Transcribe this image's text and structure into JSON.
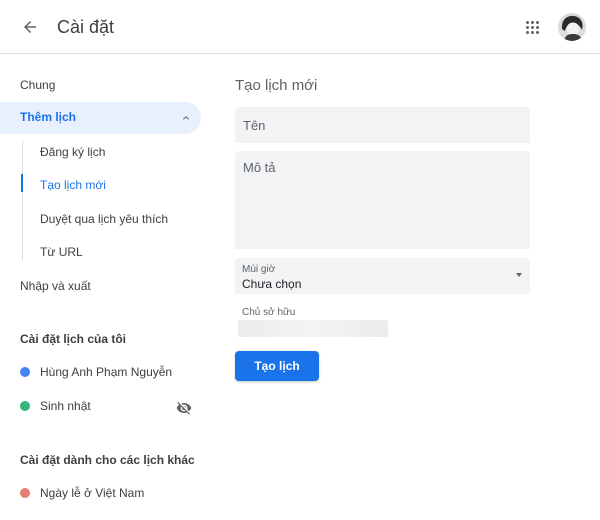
{
  "header": {
    "title": "Cài đặt",
    "back_icon": "arrow-left-icon",
    "apps_icon": "apps-grid-icon"
  },
  "sidebar": {
    "general": "Chung",
    "add_calendar": {
      "label": "Thêm lịch",
      "expanded": true,
      "children": [
        {
          "label": "Đăng ký lịch",
          "active": false
        },
        {
          "label": "Tạo lịch mới",
          "active": true
        },
        {
          "label": "Duyệt qua lịch yêu thích",
          "active": false
        },
        {
          "label": "Từ URL",
          "active": false
        }
      ]
    },
    "import_export": "Nhập và xuất",
    "my_calendars": {
      "title": "Cài đặt lịch của tôi",
      "items": [
        {
          "label": "Hùng Anh Phạm Nguyễn",
          "color": "#4285f4"
        },
        {
          "label": "Sinh nhật",
          "color": "#33b679",
          "hidden_icon": "eye-off-icon"
        }
      ]
    },
    "other_calendars": {
      "title": "Cài đặt dành cho các lịch khác",
      "items": [
        {
          "label": "Ngày lễ ở Việt Nam",
          "color": "#e67c73"
        }
      ]
    }
  },
  "main": {
    "title": "Tạo lịch mới",
    "name_placeholder": "Tên",
    "description_placeholder": "Mô tả",
    "timezone": {
      "label": "Múi giờ",
      "value": "Chưa chọn"
    },
    "owner_label": "Chủ sở hữu",
    "create_button": "Tạo lịch"
  },
  "colors": {
    "accent": "#1a73e8",
    "active_bg": "#e8f0fe",
    "field_bg": "#f1f3f4"
  }
}
